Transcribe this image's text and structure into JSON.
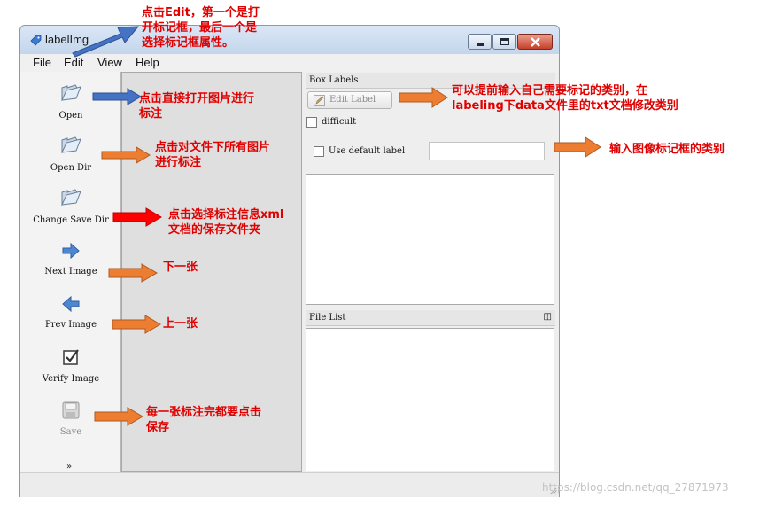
{
  "window": {
    "title": "labelImg",
    "menu": [
      "File",
      "Edit",
      "View",
      "Help"
    ]
  },
  "toolbar": {
    "open": "Open",
    "open_dir": "Open Dir",
    "change_save_dir": "Change Save Dir",
    "next_image": "Next Image",
    "prev_image": "Prev Image",
    "verify_image": "Verify Image",
    "save": "Save"
  },
  "box_labels": {
    "header": "Box Labels",
    "edit_label": "Edit Label",
    "difficult": "difficult",
    "use_default_label": "Use default label",
    "default_label_value": ""
  },
  "file_list": {
    "header": "File List"
  },
  "annotations": {
    "edit_menu": [
      "点击Edit，第一个是打",
      "开标记框，最后一个是",
      "选择标记框属性。"
    ],
    "open": [
      "点击直接打开图片进行",
      "标注"
    ],
    "open_dir": [
      "点击对文件下所有图片",
      "进行标注"
    ],
    "change_save_dir": [
      "点击选择标注信息xml",
      "文档的保存文件夹"
    ],
    "next_image": "下一张",
    "prev_image": "上一张",
    "save": [
      "每一张标注完都要点击",
      "保存"
    ],
    "edit_label": [
      "可以提前输入自己需要标记的类别，在",
      "labeling下data文件里的txt文档修改类别"
    ],
    "default_label": "输入图像标记框的类别"
  },
  "watermark": "https://blog.csdn.net/qq_27871973",
  "colors": {
    "arrow_orange": "#ed7d31",
    "arrow_blue": "#4472c4",
    "arrow_red": "#ff0000",
    "annotation_text": "#e00000"
  },
  "icons": [
    "tag-icon",
    "folder-open-icon",
    "arrow-right-icon",
    "arrow-left-icon",
    "checkbox-check-icon",
    "save-icon",
    "chevron-double-down-icon",
    "pencil-icon",
    "float-icon"
  ]
}
